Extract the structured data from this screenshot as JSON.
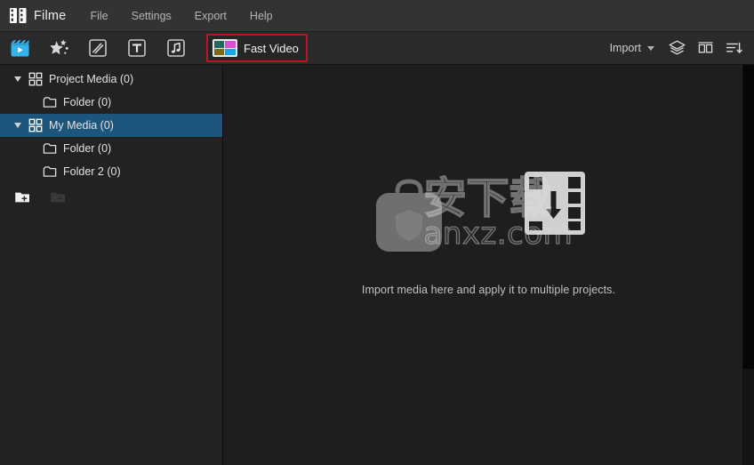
{
  "app": {
    "brand": "Filme",
    "brand_icon": "film-clapper-logo-icon"
  },
  "menubar": {
    "items": [
      {
        "label": "File",
        "name": "menu-file"
      },
      {
        "label": "Settings",
        "name": "menu-settings"
      },
      {
        "label": "Export",
        "name": "menu-export"
      },
      {
        "label": "Help",
        "name": "menu-help"
      }
    ]
  },
  "toolbar": {
    "left_tools": [
      {
        "name": "media-library-icon",
        "title": "Media",
        "active": true
      },
      {
        "name": "effects-icon",
        "title": "Effects",
        "active": false
      },
      {
        "name": "transitions-icon",
        "title": "Transitions",
        "active": false
      },
      {
        "name": "text-icon",
        "title": "Text",
        "active": false
      },
      {
        "name": "audio-music-icon",
        "title": "Audio",
        "active": false
      }
    ],
    "fast_video": {
      "label": "Fast Video",
      "icon": "fast-video-icon",
      "highlight_color": "#c1121f"
    },
    "import": {
      "label": "Import",
      "caret": "chevron-down-icon"
    },
    "right_icons": [
      {
        "name": "layers-icon",
        "title": "Layers"
      },
      {
        "name": "grid-view-icon",
        "title": "Grid View"
      },
      {
        "name": "sort-list-icon",
        "title": "Sort"
      }
    ]
  },
  "sidebar": {
    "tree": [
      {
        "label": "Project Media (0)",
        "name": "tree-item-project-media",
        "icon": "grid-squares-icon",
        "depth": 0,
        "expandable": true,
        "expanded": true,
        "selected": false
      },
      {
        "label": "Folder (0)",
        "name": "tree-item-project-media-folder",
        "icon": "folder-icon",
        "depth": 1,
        "expandable": false,
        "expanded": false,
        "selected": false
      },
      {
        "label": "My Media (0)",
        "name": "tree-item-my-media",
        "icon": "grid-squares-icon",
        "depth": 0,
        "expandable": true,
        "expanded": true,
        "selected": true
      },
      {
        "label": "Folder (0)",
        "name": "tree-item-my-media-folder",
        "icon": "folder-icon",
        "depth": 1,
        "expandable": false,
        "expanded": false,
        "selected": false
      },
      {
        "label": "Folder 2 (0)",
        "name": "tree-item-my-media-folder-2",
        "icon": "folder-icon",
        "depth": 1,
        "expandable": false,
        "expanded": false,
        "selected": false
      }
    ],
    "actions": [
      {
        "name": "new-folder-icon",
        "title": "New Folder",
        "enabled": true
      },
      {
        "name": "delete-folder-icon",
        "title": "Delete Folder",
        "enabled": false
      }
    ],
    "selection_color": "#1d567d"
  },
  "main": {
    "hint": "Import media here and apply it to multiple projects.",
    "placeholder_icons": [
      "media-bag-icon",
      "film-strip-download-icon"
    ],
    "watermark": {
      "cn": "安下载",
      "en": "anxz.com"
    }
  }
}
